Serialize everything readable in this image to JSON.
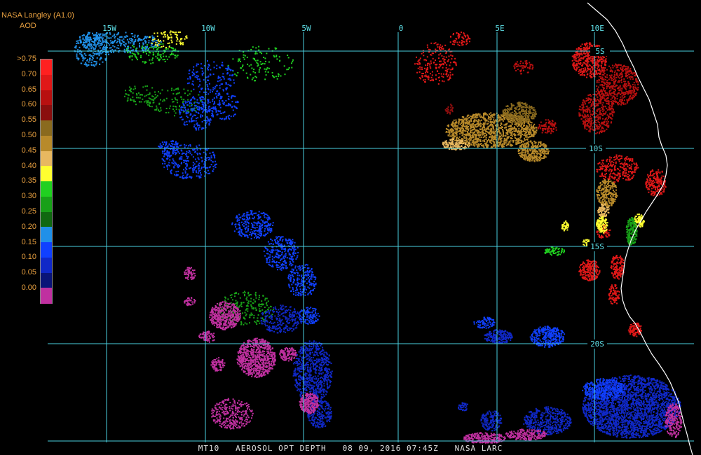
{
  "header": {
    "source": "NASA Langley (A1.0)",
    "variable": "AOD"
  },
  "legend": {
    "entries": [
      {
        "label": ">0.75",
        "color": "#ff2020"
      },
      {
        "label": "0.70",
        "color": "#e01818"
      },
      {
        "label": "0.65",
        "color": "#b81010"
      },
      {
        "label": "0.60",
        "color": "#8a0e0e"
      },
      {
        "label": "0.55",
        "color": "#8a6a1e"
      },
      {
        "label": "0.50",
        "color": "#b88a2a"
      },
      {
        "label": "0.45",
        "color": "#e8b860"
      },
      {
        "label": "0.40",
        "color": "#ffff30"
      },
      {
        "label": "0.35",
        "color": "#20d020"
      },
      {
        "label": "0.30",
        "color": "#18a018"
      },
      {
        "label": "0.25",
        "color": "#106810"
      },
      {
        "label": "0.20",
        "color": "#2090e8"
      },
      {
        "label": "0.15",
        "color": "#1040ff"
      },
      {
        "label": "0.10",
        "color": "#1028c8"
      },
      {
        "label": "0.05",
        "color": "#0a1478"
      },
      {
        "label": "0.00",
        "color": "#c030a0"
      }
    ]
  },
  "grid": {
    "lon_labels": [
      "15W",
      "10W",
      "5W",
      "0",
      "5E",
      "10E"
    ],
    "lat_labels": [
      "5S",
      "10S",
      "15S",
      "20S"
    ],
    "line_color": "#4ad0e0"
  },
  "footer": {
    "product": "MT10",
    "title": "AEROSOL OPT DEPTH",
    "date": "08 09, 2016",
    "time": "07:45Z",
    "credit": "NASA LARC"
  },
  "colors": {
    "coastline": "#ffffff",
    "background": "#000000"
  }
}
